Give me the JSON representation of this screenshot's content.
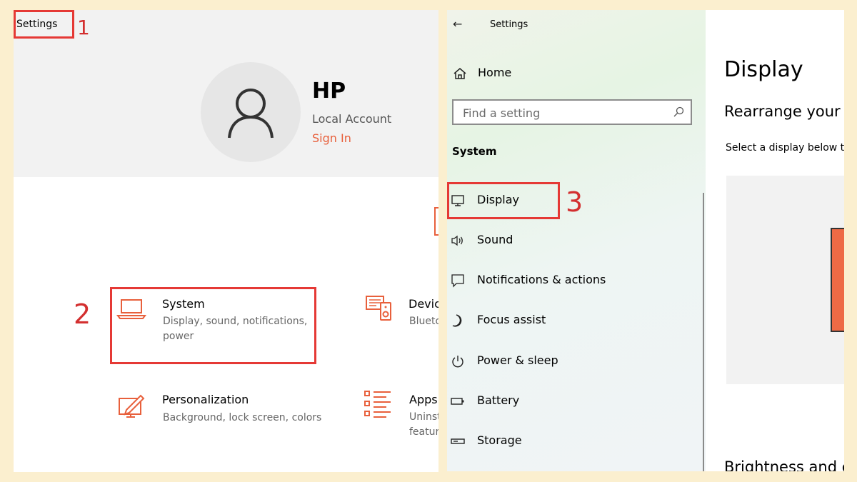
{
  "window": {
    "title": "Settings"
  },
  "account": {
    "name": "HP",
    "type": "Local Account",
    "sign_in": "Sign In"
  },
  "tiles": [
    {
      "title": "System",
      "desc": "Display, sound, notifications, power",
      "icon": "laptop-icon"
    },
    {
      "title": "Devic",
      "desc": "Blueto",
      "icon": "devices-icon"
    },
    {
      "title": "Personalization",
      "desc": "Background, lock screen, colors",
      "icon": "personalization-icon"
    },
    {
      "title": "Apps",
      "desc": "Uninst featur",
      "icon": "apps-icon"
    }
  ],
  "nav": {
    "back": "←",
    "title": "Settings",
    "home": "Home",
    "search_placeholder": "Find a setting",
    "section": "System",
    "items": [
      {
        "label": "Display",
        "icon": "monitor-icon"
      },
      {
        "label": "Sound",
        "icon": "speaker-icon"
      },
      {
        "label": "Notifications & actions",
        "icon": "notification-icon"
      },
      {
        "label": "Focus assist",
        "icon": "moon-icon"
      },
      {
        "label": "Power & sleep",
        "icon": "power-icon"
      },
      {
        "label": "Battery",
        "icon": "battery-icon"
      },
      {
        "label": "Storage",
        "icon": "storage-icon"
      }
    ]
  },
  "content": {
    "title": "Display",
    "subtitle": "Rearrange your d",
    "text": "Select a display below t",
    "bottom": "Brightness and c"
  },
  "annotations": {
    "step1": "1",
    "step2": "2",
    "step3": "3"
  },
  "colors": {
    "accent": "#e8603c",
    "annotation": "#e53935",
    "background": "#fbefcf"
  }
}
